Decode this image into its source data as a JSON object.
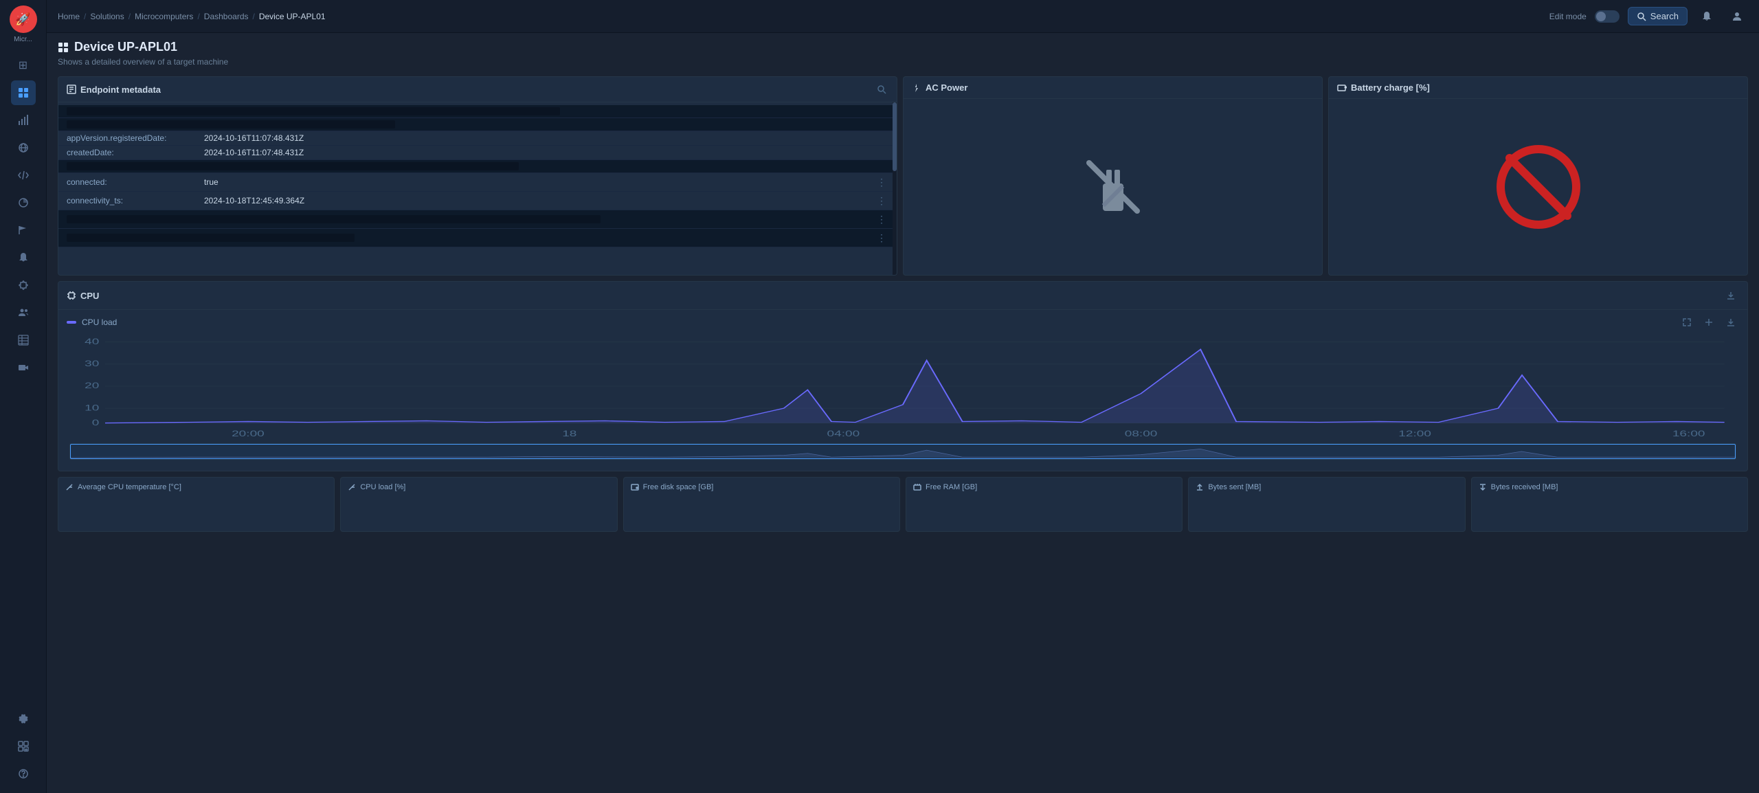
{
  "app": {
    "name": "Micr...",
    "logo": "🚀"
  },
  "sidebar": {
    "items": [
      {
        "id": "grid",
        "icon": "⊞",
        "active": false
      },
      {
        "id": "apps",
        "icon": "⋮⋮",
        "active": false
      },
      {
        "id": "signal",
        "icon": "📶",
        "active": false
      },
      {
        "id": "globe",
        "icon": "🌐",
        "active": false
      },
      {
        "id": "code",
        "icon": "</>",
        "active": false
      },
      {
        "id": "chart",
        "icon": "📊",
        "active": true
      },
      {
        "id": "flag",
        "icon": "🚩",
        "active": false
      },
      {
        "id": "bell",
        "icon": "🔔",
        "active": false
      },
      {
        "id": "puzzle",
        "icon": "🧩",
        "active": false
      },
      {
        "id": "users",
        "icon": "👥",
        "active": false
      },
      {
        "id": "table",
        "icon": "▦",
        "active": false
      },
      {
        "id": "video",
        "icon": "📹",
        "active": false
      },
      {
        "id": "settings",
        "icon": "⚙",
        "active": false
      },
      {
        "id": "extensions",
        "icon": "⊞+",
        "active": false
      },
      {
        "id": "help",
        "icon": "?",
        "active": false
      }
    ]
  },
  "topbar": {
    "breadcrumbs": [
      "Home",
      "Solutions",
      "Microcomputers",
      "Dashboards",
      "Device UP-APL01"
    ],
    "edit_mode_label": "Edit mode",
    "search_label": "Search"
  },
  "page": {
    "title": "Device UP-APL01",
    "subtitle": "Shows a detailed overview of a target machine",
    "icon": "⊞"
  },
  "panels": {
    "endpoint_metadata": {
      "title": "Endpoint metadata",
      "rows": [
        {
          "key": "",
          "value": "",
          "redacted": true,
          "redacted_width": "60%"
        },
        {
          "key": "",
          "value": "",
          "redacted": true,
          "redacted_width": "40%"
        },
        {
          "key": "appVersion.registeredDate:",
          "value": "2024-10-16T11:07:48.431Z",
          "redacted": false
        },
        {
          "key": "createdDate:",
          "value": "2024-10-16T11:07:48.431Z",
          "redacted": false
        },
        {
          "key": "",
          "value": "",
          "redacted": true,
          "redacted_width": "55%"
        },
        {
          "key": "connected:",
          "value": "true",
          "redacted": false,
          "has_menu": true
        },
        {
          "key": "connectivity_ts:",
          "value": "2024-10-18T12:45:49.364Z",
          "redacted": false,
          "has_menu": true
        },
        {
          "key": "",
          "value": "",
          "redacted": true,
          "redacted_width": "65%",
          "has_menu": true
        },
        {
          "key": "",
          "value": "",
          "redacted": true,
          "redacted_width": "35%",
          "has_menu": true
        }
      ]
    },
    "ac_power": {
      "title": "AC Power"
    },
    "battery_charge": {
      "title": "Battery charge [%]"
    },
    "cpu": {
      "title": "CPU",
      "legend": [
        {
          "label": "CPU load",
          "color": "#6a6aff"
        }
      ],
      "y_labels": [
        "40",
        "30",
        "20",
        "10",
        "0"
      ],
      "x_labels": [
        "20:00",
        "18",
        "04:00",
        "08:00",
        "12:00",
        "16:00"
      ]
    }
  },
  "bottom_metrics": [
    {
      "title": "Average CPU temperature [°C]",
      "icon": "↗"
    },
    {
      "title": "CPU load [%]",
      "icon": "↗"
    },
    {
      "title": "Free disk space [GB]",
      "icon": "💾"
    },
    {
      "title": "Free RAM [GB]",
      "icon": "⬛"
    },
    {
      "title": "Bytes sent [MB]",
      "icon": "↑"
    },
    {
      "title": "Bytes received [MB]",
      "icon": "↓"
    }
  ]
}
